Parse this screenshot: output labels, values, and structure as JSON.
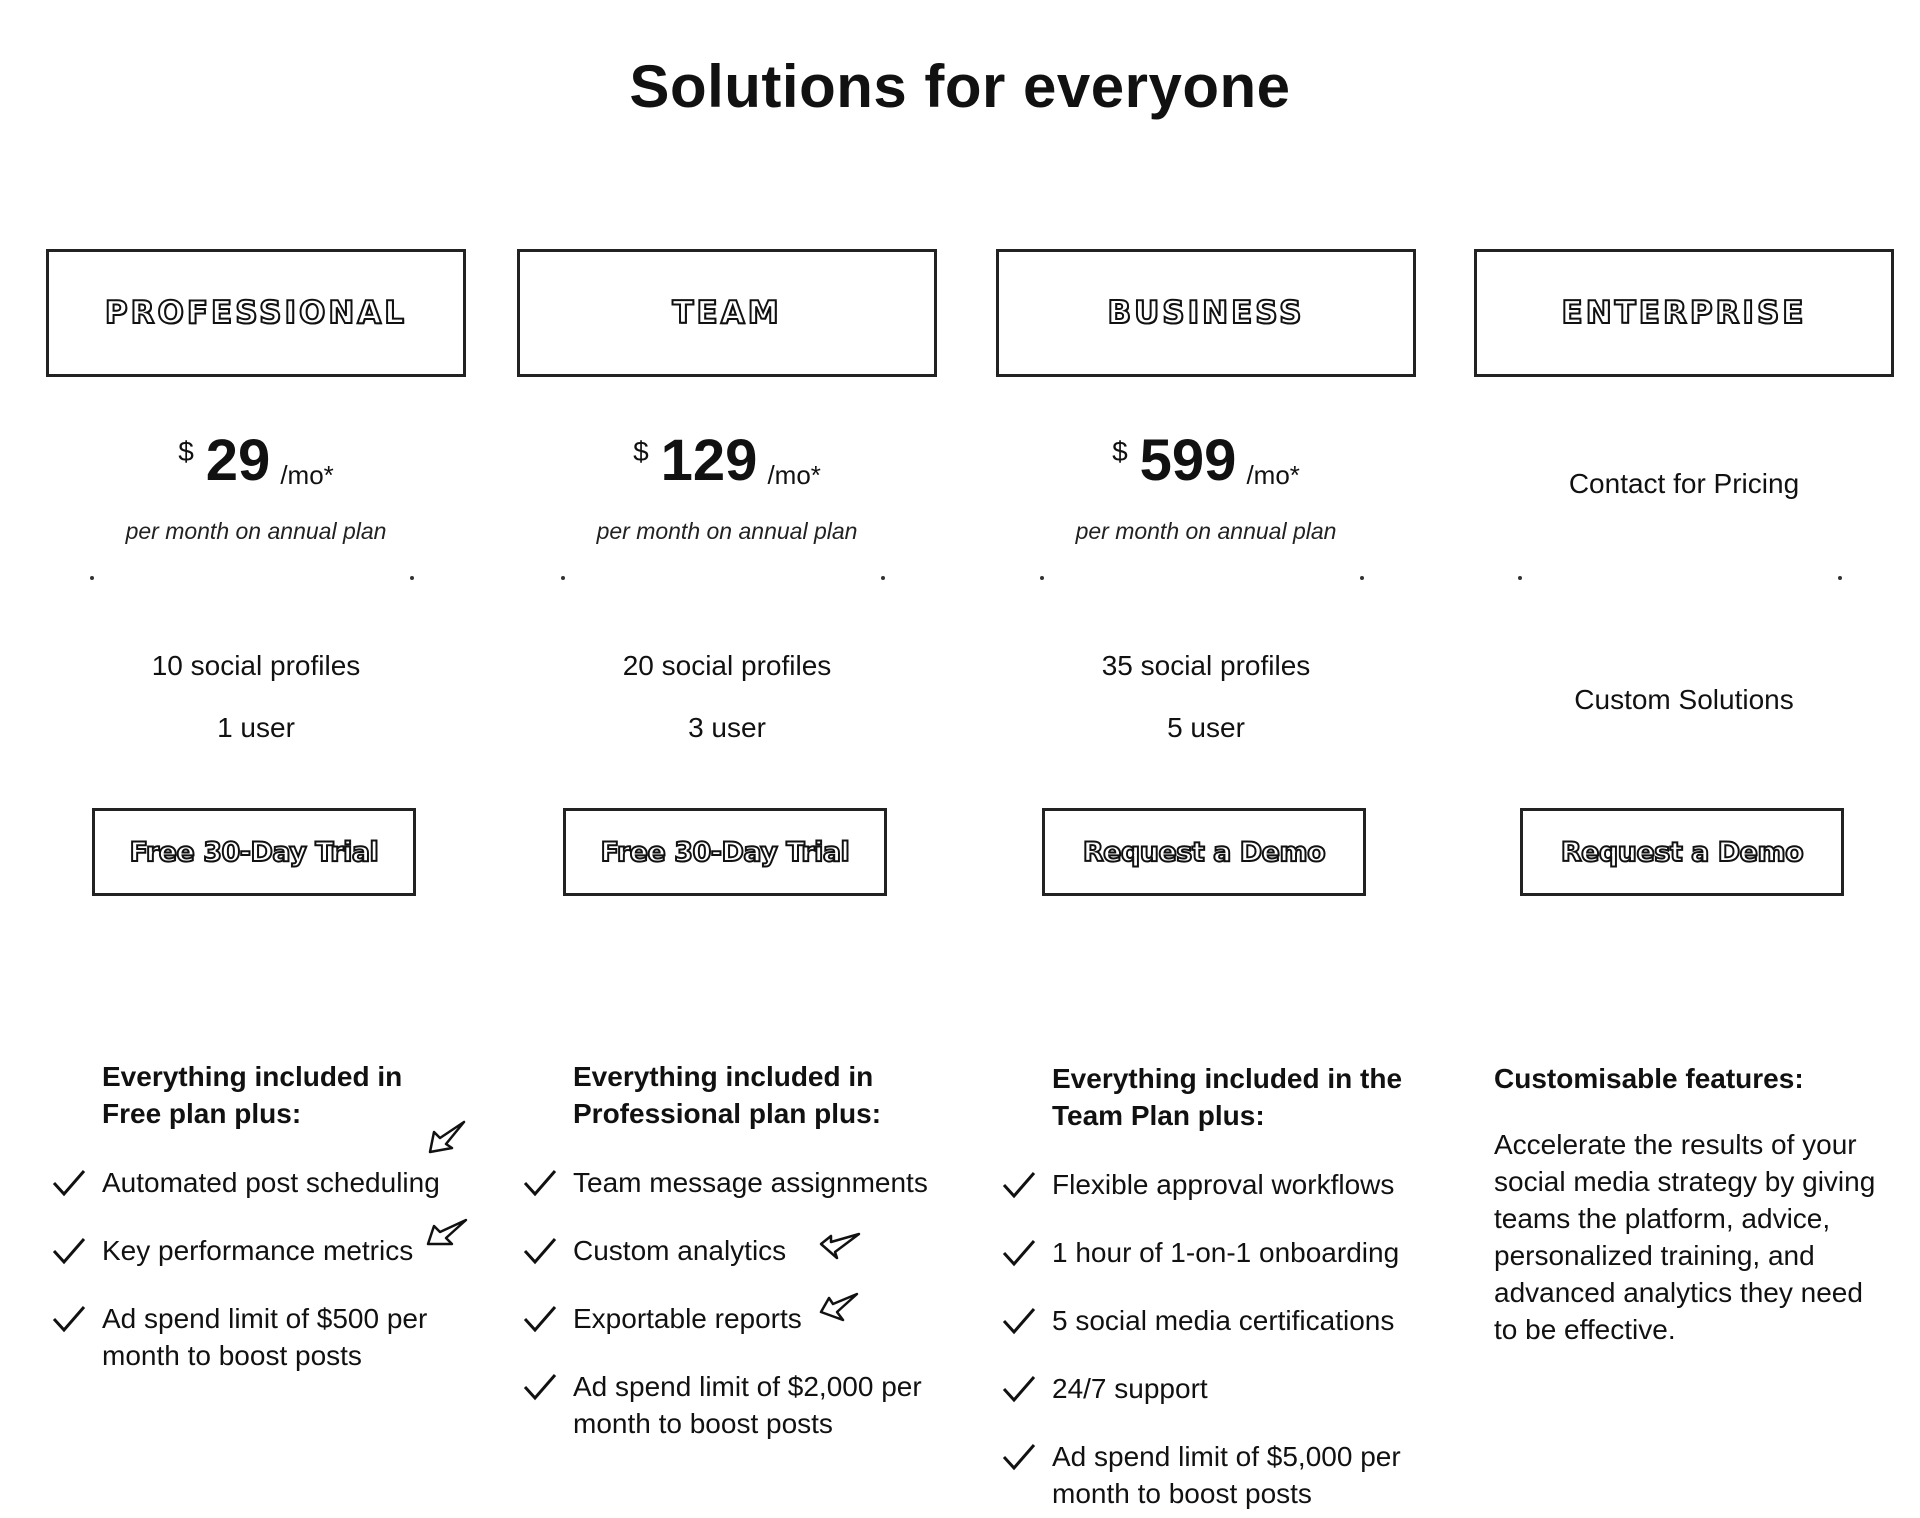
{
  "title": "Solutions for everyone",
  "plans": [
    {
      "name": "PROFESSIONAL",
      "currency": "$",
      "price": "29",
      "per": "/mo*",
      "annual": "per month on annual plan",
      "profiles": "10 social profiles",
      "users": "1 user",
      "cta": "Free 30-Day Trial",
      "heading": "Everything included in Free plan plus:",
      "features": [
        "Automated post scheduling",
        "Key performance metrics",
        "Ad spend limit of $500 per month to boost posts"
      ]
    },
    {
      "name": "TEAM",
      "currency": "$",
      "price": "129",
      "per": "/mo*",
      "annual": "per month on annual plan",
      "profiles": "20 social profiles",
      "users": "3 user",
      "cta": "Free 30-Day Trial",
      "heading": "Everything included in Professional plan plus:",
      "features": [
        "Team message assignments",
        "Custom analytics",
        "Exportable reports",
        "Ad spend limit of $2,000 per month to boost posts"
      ]
    },
    {
      "name": "BUSINESS",
      "currency": "$",
      "price": "599",
      "per": "/mo*",
      "annual": "per month on annual plan",
      "profiles": "35 social profiles",
      "users": "5 user",
      "cta": "Request a Demo",
      "heading": "Everything included in the Team Plan plus:",
      "features": [
        "Flexible approval workflows",
        "1 hour of 1-on-1 onboarding",
        "5 social media certifications",
        "24/7 support",
        "Ad spend limit of $5,000 per month to boost posts"
      ]
    },
    {
      "name": "ENTERPRISE",
      "contact": "Contact for Pricing",
      "custom": "Custom Solutions",
      "cta": "Request a Demo",
      "heading": "Customisable features:",
      "body": "Accelerate the results of your social media strategy by giving teams the platform, advice, personalized training, and advanced analytics they need to be effective."
    }
  ],
  "icons": {
    "check": "check-icon",
    "arrow": "arrow-pointer-icon"
  }
}
